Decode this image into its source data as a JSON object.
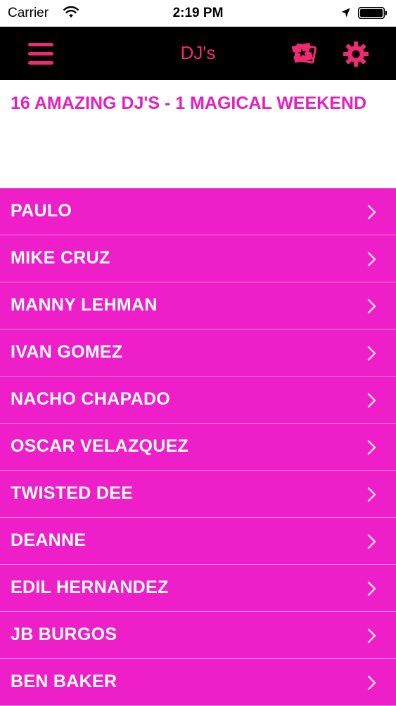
{
  "status_bar": {
    "carrier": "Carrier",
    "time": "2:19 PM"
  },
  "nav": {
    "title": "DJ's"
  },
  "header": {
    "headline": "16 AMAZING DJ'S - 1 MAGICAL WEEKEND"
  },
  "djs": [
    {
      "name": "PAULO"
    },
    {
      "name": "MIKE CRUZ"
    },
    {
      "name": "MANNY LEHMAN"
    },
    {
      "name": "IVAN GOMEZ"
    },
    {
      "name": "NACHO CHAPADO"
    },
    {
      "name": "OSCAR VELAZQUEZ"
    },
    {
      "name": "TWISTED DEE"
    },
    {
      "name": "DEANNE"
    },
    {
      "name": "EDIL HERNANDEZ"
    },
    {
      "name": "JB BURGOS"
    },
    {
      "name": "BEN BAKER"
    }
  ],
  "colors": {
    "accent_pink": "#ee2a72",
    "list_background": "#ee1ec8",
    "headline_magenta": "#e51fc0",
    "nav_background": "#000000"
  },
  "icons": {
    "menu": "hamburger-icon",
    "ticket": "ticket-icon",
    "settings": "gear-icon",
    "row_disclosure": "chevron-right-icon"
  }
}
